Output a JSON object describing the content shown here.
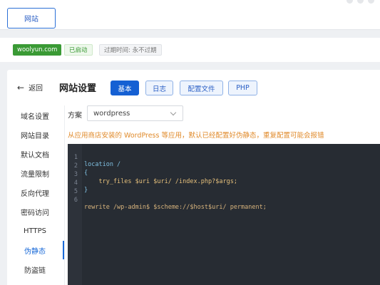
{
  "top_tab": {
    "label": "网站"
  },
  "info": {
    "domain": "woolyun.com",
    "status": "已启动",
    "expire": "过期时间: 永不过期"
  },
  "header": {
    "back_label": "返回",
    "title": "网站设置",
    "tabs": [
      {
        "label": "基本",
        "active": true
      },
      {
        "label": "日志",
        "active": false
      },
      {
        "label": "配置文件",
        "active": false
      },
      {
        "label": "PHP",
        "active": false
      }
    ]
  },
  "sidebar": {
    "items": [
      {
        "label": "域名设置"
      },
      {
        "label": "网站目录"
      },
      {
        "label": "默认文档"
      },
      {
        "label": "流量限制"
      },
      {
        "label": "反向代理"
      },
      {
        "label": "密码访问"
      },
      {
        "label": "HTTPS"
      },
      {
        "label": "伪静态",
        "active": true
      },
      {
        "label": "防盗链"
      }
    ]
  },
  "scheme": {
    "label": "方案",
    "value": "wordpress"
  },
  "tip": "从应用商店安装的 WordPress 等应用，默认已经配置好伪静态，重复配置可能会报错",
  "editor": {
    "lines": [
      {
        "n": "1",
        "text": "location /"
      },
      {
        "n": "2",
        "text": "{"
      },
      {
        "n": "3",
        "text": "    try_files $uri $uri/ /index.php?$args;"
      },
      {
        "n": "4",
        "text": "}"
      },
      {
        "n": "5",
        "text": ""
      },
      {
        "n": "6",
        "text": "rewrite /wp-admin$ $scheme://$host$uri/ permanent;"
      }
    ]
  },
  "colors": {
    "accent": "#1560d3",
    "success": "#3a9a35",
    "warning": "#e08a2a",
    "editor_bg": "#272c33"
  }
}
